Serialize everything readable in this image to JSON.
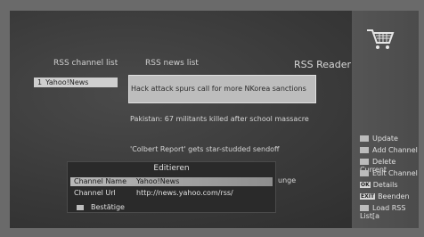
{
  "app": {
    "title": "RSS Reader"
  },
  "channels": {
    "header": "RSS channel list",
    "items": [
      {
        "index": "1",
        "name": "Yahoo!News"
      }
    ]
  },
  "news": {
    "header": "RSS news list",
    "items": [
      "Hack attack spurs call for more NKorea sanctions",
      "Pakistan: 67 militants killed after school massacre",
      "'Colbert Report' gets star-studded sendoff"
    ],
    "overflow_fragment": "unge"
  },
  "dialog": {
    "title": "Editieren",
    "rows": [
      {
        "label": "Channel Name",
        "value": "Yahoo!News"
      },
      {
        "label": "Channel Url",
        "value": "http://news.yahoo.com/rss/"
      }
    ],
    "confirm_label": "Bestätige"
  },
  "menu": {
    "items": [
      {
        "key": "",
        "label": "Update"
      },
      {
        "key": "",
        "label": "Add Channel"
      },
      {
        "key": "",
        "label": "Delete Current"
      },
      {
        "key": "",
        "label": "Edit Channel"
      },
      {
        "key": "OK",
        "label": "Details"
      },
      {
        "key": "EXIT",
        "label": "Beenden"
      },
      {
        "key": "",
        "label": "Load RSS List[a"
      }
    ]
  },
  "colors": {
    "panel": "#4b4b4b",
    "highlight": "#bdbdbd",
    "text": "#e0e0e0"
  }
}
